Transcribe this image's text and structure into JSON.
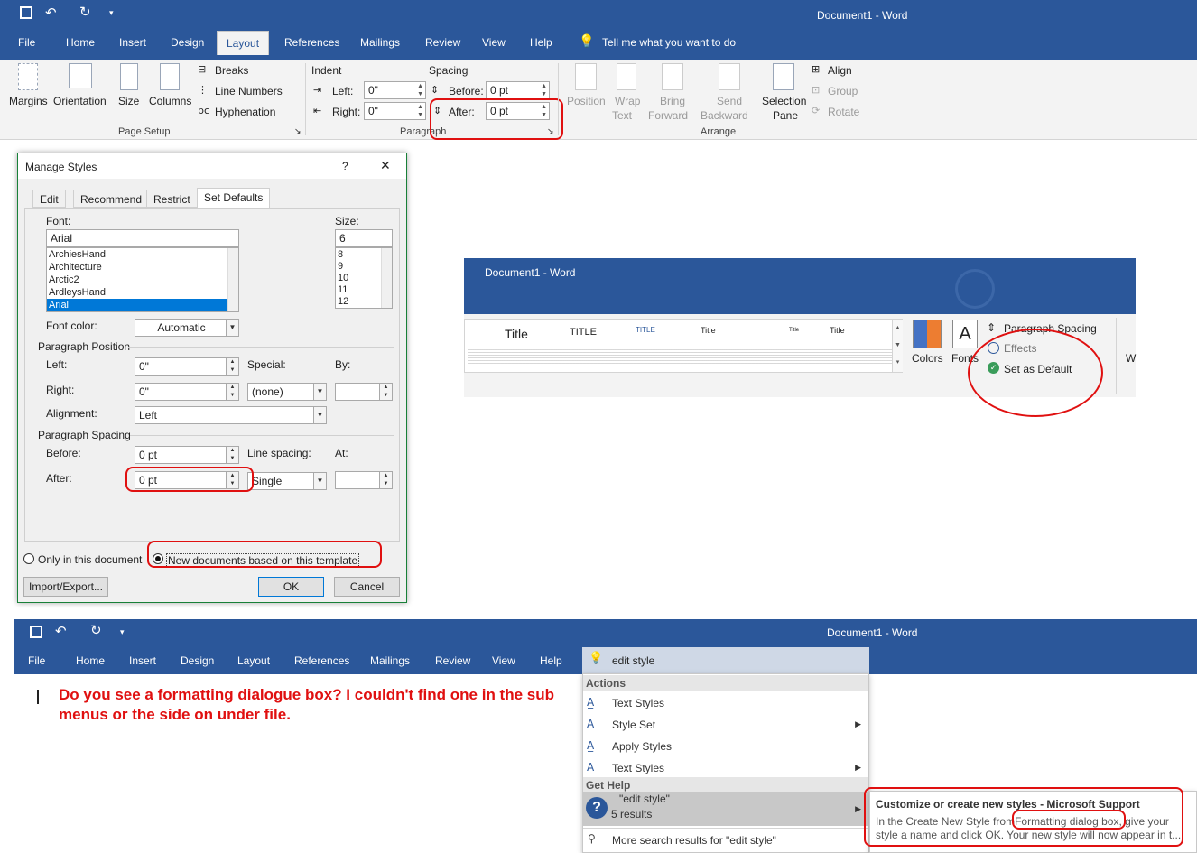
{
  "top_window": {
    "title": "Document1 - Word",
    "tabs": [
      "File",
      "Home",
      "Insert",
      "Design",
      "Layout",
      "References",
      "Mailings",
      "Review",
      "View",
      "Help"
    ],
    "tell_me": "Tell me what you want to do",
    "page_setup": {
      "margins": "Margins",
      "orientation": "Orientation",
      "size": "Size",
      "columns": "Columns",
      "breaks": "Breaks",
      "line_numbers": "Line Numbers",
      "hyphenation": "Hyphenation",
      "group_label": "Page Setup"
    },
    "paragraph": {
      "indent_label": "Indent",
      "spacing_label": "Spacing",
      "left_label": "Left:",
      "left_value": "0\"",
      "right_label": "Right:",
      "right_value": "0\"",
      "before_label": "Before:",
      "before_value": "0 pt",
      "after_label": "After:",
      "after_value": "0 pt",
      "group_label": "Paragraph"
    },
    "arrange": {
      "position": "Position",
      "wrap_text_1": "Wrap",
      "wrap_text_2": "Text",
      "bring_forward_1": "Bring",
      "bring_forward_2": "Forward",
      "send_backward_1": "Send",
      "send_backward_2": "Backward",
      "selection_pane_1": "Selection",
      "selection_pane_2": "Pane",
      "align": "Align",
      "group": "Group",
      "rotate": "Rotate",
      "group_label": "Arrange"
    }
  },
  "dialog": {
    "title": "Manage Styles",
    "help": "?",
    "close": "✕",
    "tabs": [
      "Edit",
      "Recommend",
      "Restrict",
      "Set Defaults"
    ],
    "font_label": "Font:",
    "font_value": "Arial",
    "font_list": [
      "ArchiesHand",
      "Architecture",
      "Arctic2",
      "ArdleysHand",
      "Arial"
    ],
    "size_label": "Size:",
    "size_value": "6",
    "size_list": [
      "8",
      "9",
      "10",
      "11",
      "12"
    ],
    "font_color_label": "Font color:",
    "font_color_value": "Automatic",
    "para_position": "Paragraph Position",
    "left_label": "Left:",
    "left_value": "0\"",
    "special_label": "Special:",
    "by_label": "By:",
    "right_label": "Right:",
    "right_value": "0\"",
    "special_value": "(none)",
    "alignment_label": "Alignment:",
    "alignment_value": "Left",
    "para_spacing": "Paragraph Spacing",
    "before_label": "Before:",
    "before_value": "0 pt",
    "line_spacing_label": "Line spacing:",
    "at_label": "At:",
    "after_label": "After:",
    "after_value": "0 pt",
    "line_spacing_value": "Single",
    "radio_this_doc": "Only in this document",
    "radio_template": "New documents based on this template",
    "import_export": "Import/Export...",
    "ok": "OK",
    "cancel": "Cancel"
  },
  "design_snippet": {
    "title": "Document1 - Word",
    "styles": [
      "Title",
      "TITLE",
      "TITLE",
      "Title",
      "Title",
      "Title"
    ],
    "colors": "Colors",
    "fonts": "Fonts",
    "paragraph_spacing": "Paragraph Spacing",
    "effects": "Effects",
    "set_as_default": "Set as Default",
    "cut_letter": "W"
  },
  "bottom_window": {
    "title": "Document1 - Word",
    "tabs": [
      "File",
      "Home",
      "Insert",
      "Design",
      "Layout",
      "References",
      "Mailings",
      "Review",
      "View",
      "Help"
    ],
    "search_value": "edit style",
    "question": "Do you see a formatting dialogue box? I couldn't find one in the sub menus or the side on under file."
  },
  "search_menu": {
    "actions_header": "Actions",
    "actions": [
      "Text Styles",
      "Style Set",
      "Apply Styles",
      "Text Styles"
    ],
    "help_header": "Get Help",
    "help_item_title": "\"edit style\"",
    "help_item_count": "5 results",
    "more_results": "More search results for \"edit style\""
  },
  "tooltip": {
    "title": "Customize or create new styles - Microsoft Support",
    "body_1": "In the Create New Style from",
    "body_highlight": "Formatting dialog box",
    "body_2": ", give your",
    "body_3": "style a name and click OK. Your new style will now appear in t..."
  }
}
